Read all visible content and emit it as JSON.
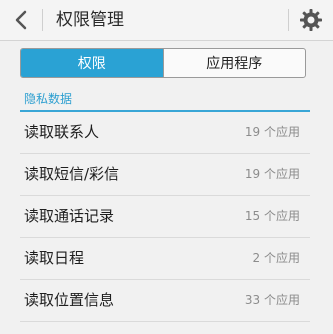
{
  "header": {
    "title": "权限管理",
    "back_icon": "chevron-left-icon",
    "settings_icon": "gear-icon"
  },
  "tabs": [
    {
      "label": "权限",
      "active": true
    },
    {
      "label": "应用程序",
      "active": false
    }
  ],
  "section": {
    "title": "隐私数据"
  },
  "permissions": [
    {
      "label": "读取联系人",
      "count": "19 个应用"
    },
    {
      "label": "读取短信/彩信",
      "count": "19 个应用"
    },
    {
      "label": "读取通话记录",
      "count": "15 个应用"
    },
    {
      "label": "读取日程",
      "count": "2 个应用"
    },
    {
      "label": "读取位置信息",
      "count": "33 个应用"
    }
  ],
  "colors": {
    "accent": "#2aa2d4",
    "background": "#f1f1f1",
    "text": "#1f1f1f",
    "secondary_text": "#8c8c8c"
  }
}
